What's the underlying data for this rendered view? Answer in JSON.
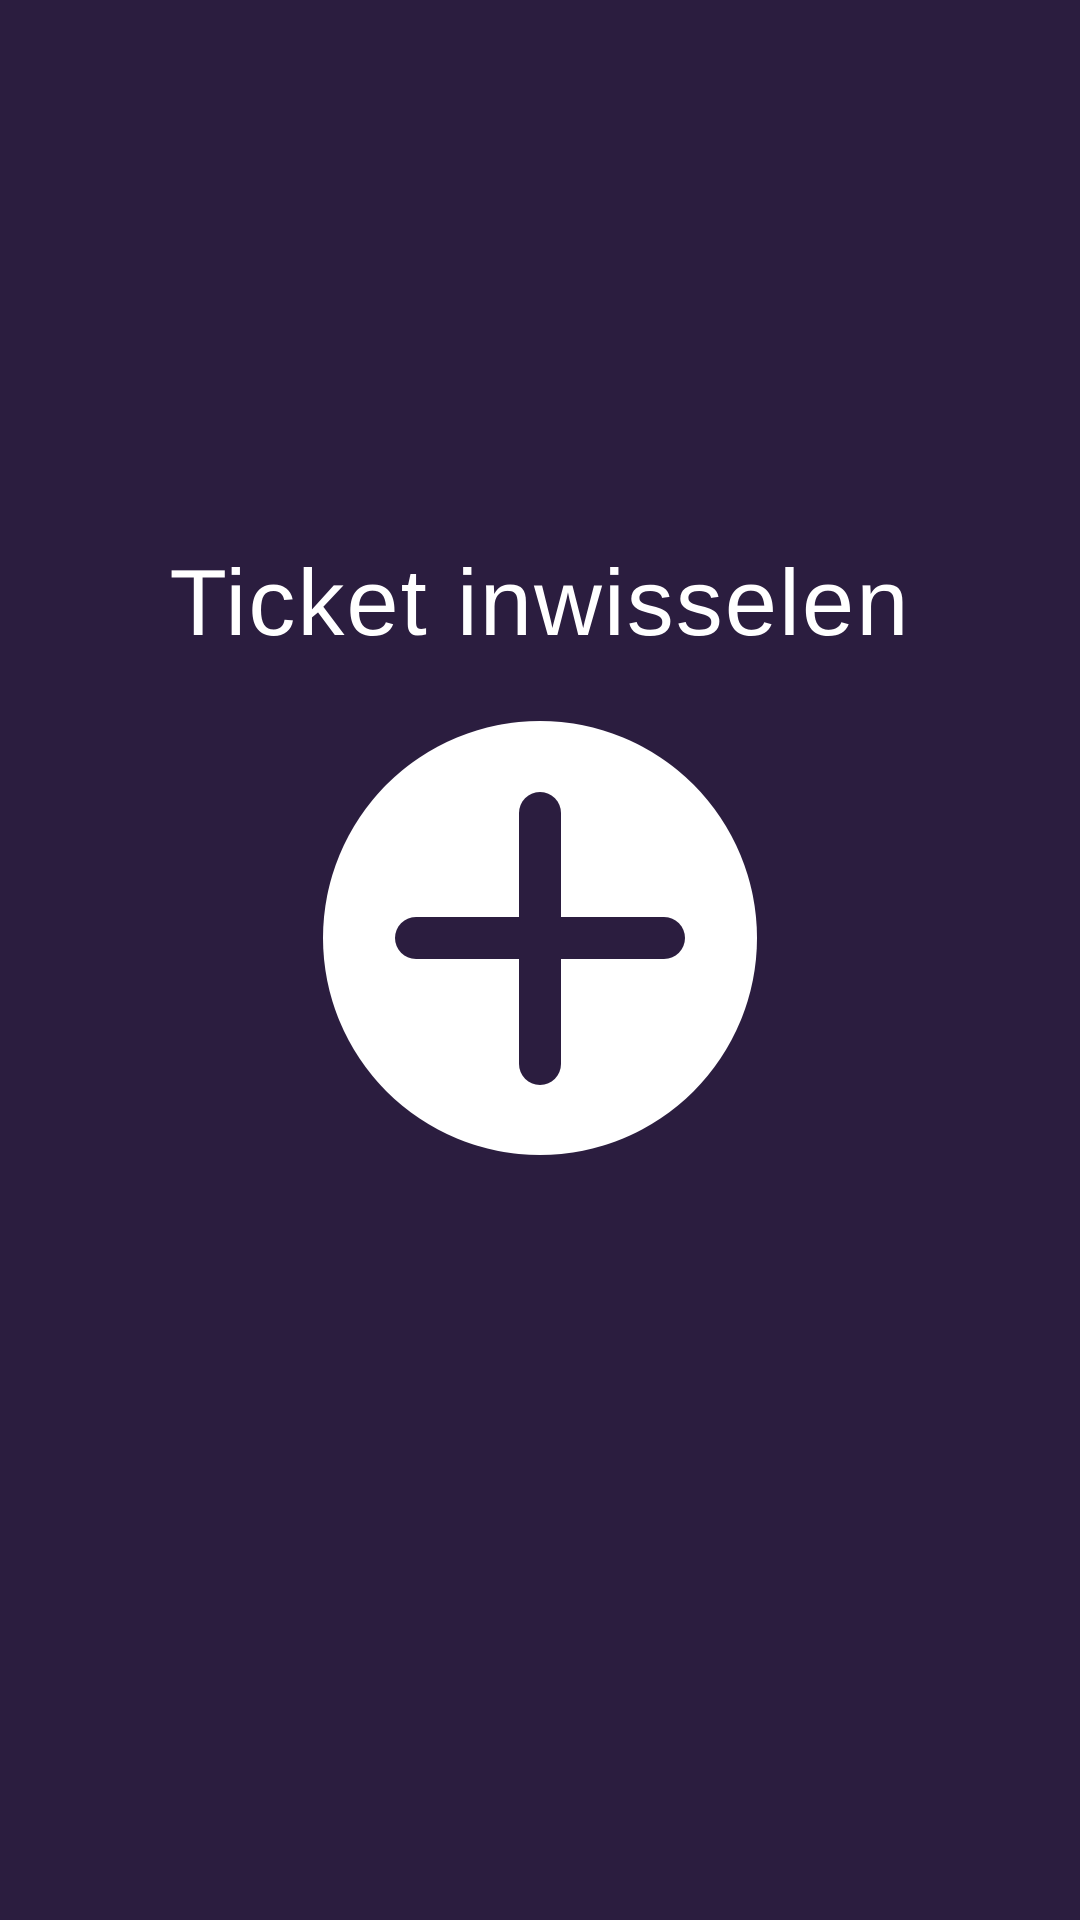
{
  "screen": {
    "title": "Ticket inwisselen"
  },
  "add_button": {
    "icon": "plus-icon"
  },
  "colors": {
    "background": "#2b1d3f",
    "foreground": "#ffffff"
  }
}
